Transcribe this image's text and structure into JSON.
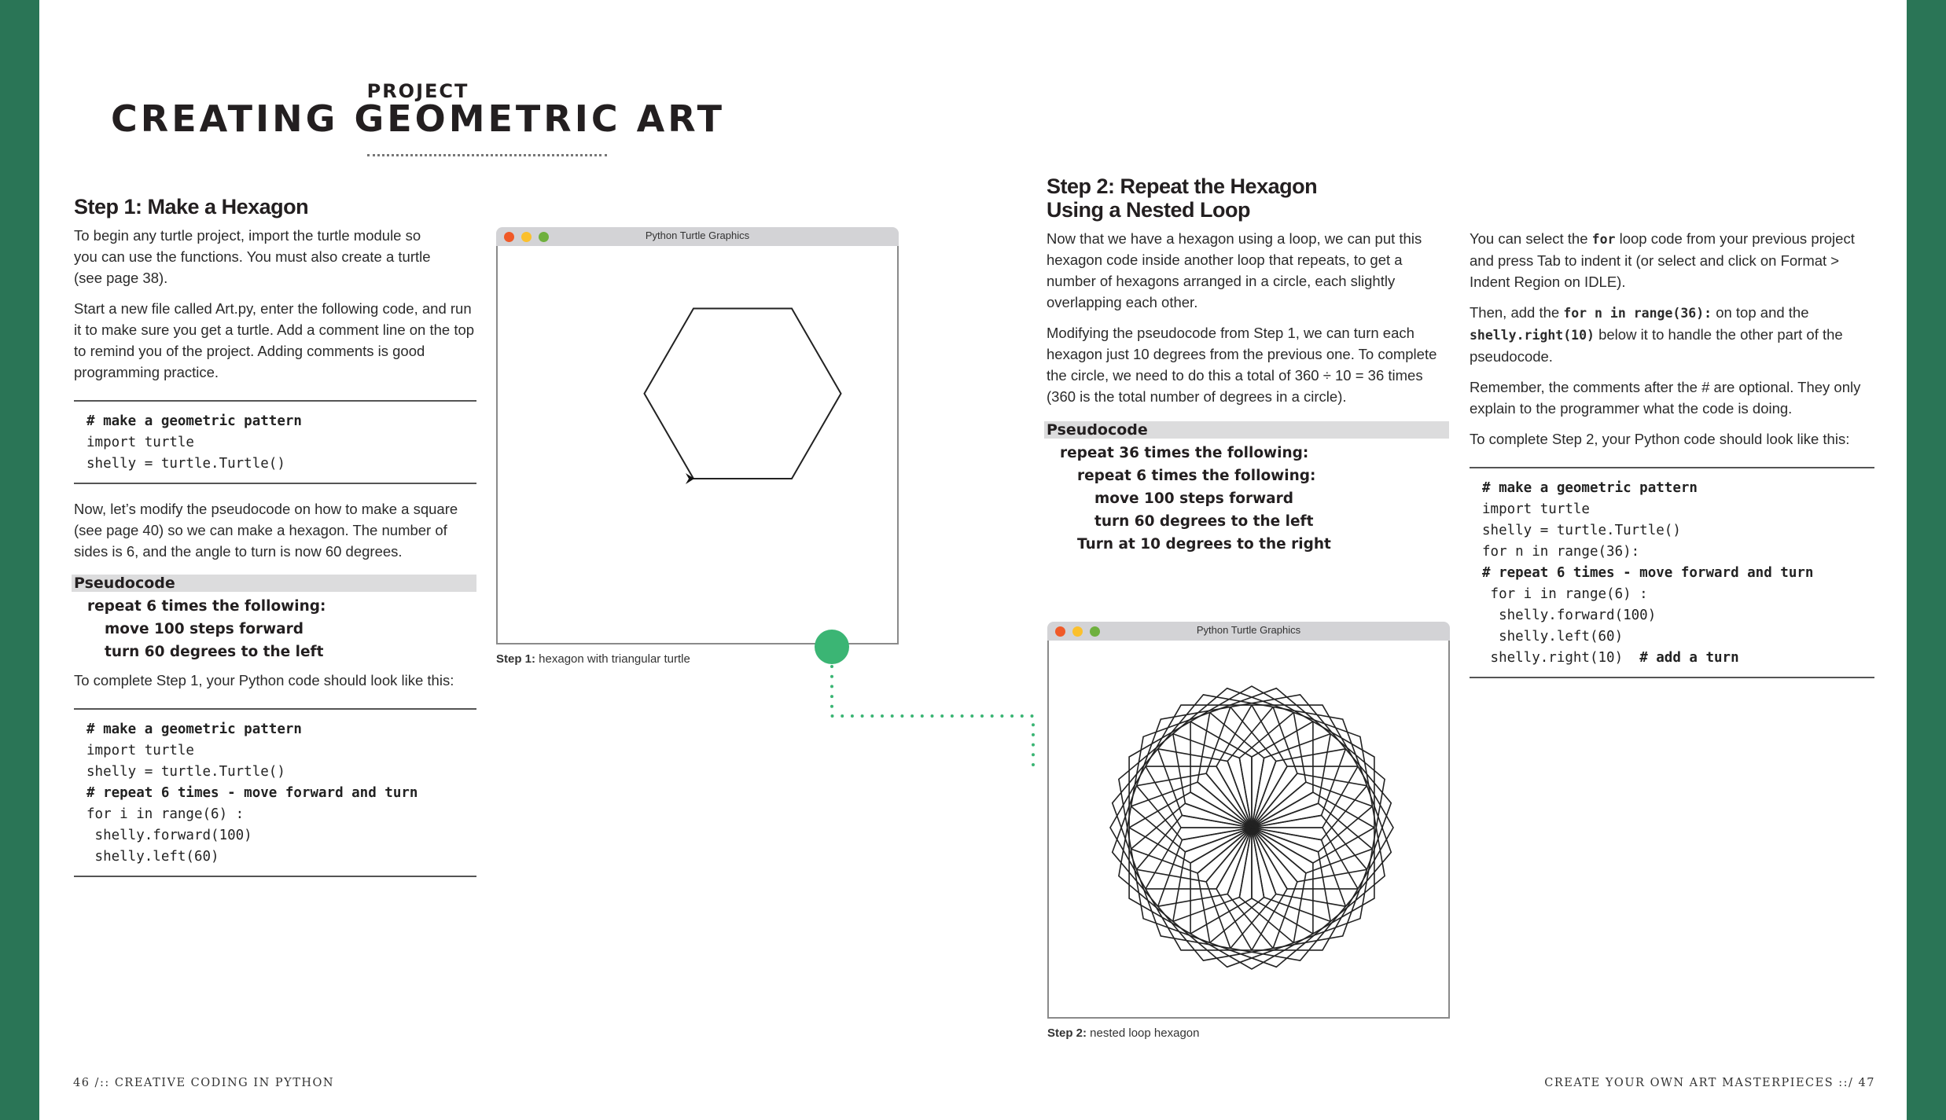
{
  "header": {
    "kicker": "PROJECT",
    "title": "CREATING GEOMETRIC ART"
  },
  "colors": {
    "sidebar_green": "#2a7556",
    "connector_green": "#3bb574",
    "window_close": "#f05a28",
    "window_minimize": "#fbc02d",
    "window_zoom": "#6fb03e"
  },
  "step1": {
    "heading": "Step 1: Make a Hexagon",
    "para1": "To begin any turtle project, import the turtle module so you can use the functions. You must also create a turtle (see page 38).",
    "para2": "Start a new file called Art.py, enter the following code, and run it to make sure you get a turtle. Add a comment line on the top to remind you of the project. Adding comments is good programming practice.",
    "code1": [
      {
        "text": "# make a geometric pattern",
        "bold": true
      },
      {
        "text": "import turtle",
        "bold": false
      },
      {
        "text": "shelly = turtle.Turtle()",
        "bold": false
      }
    ],
    "para3": "Now, let’s modify the pseudocode on how to make a square (see page 40) so we can make a hexagon. The number of sides is 6, and the angle to turn is now 60 degrees.",
    "pseudocode_label": "Pseudocode",
    "pseudocode": [
      {
        "text": "repeat 6 times the following:",
        "indent": 1
      },
      {
        "text": "move 100 steps forward",
        "indent": 2
      },
      {
        "text": "turn 60 degrees to the left",
        "indent": 2
      }
    ],
    "para4": "To complete Step 1, your Python code should look like this:",
    "code2": [
      {
        "text": "# make a geometric pattern",
        "bold": true
      },
      {
        "text": "import turtle",
        "bold": false
      },
      {
        "text": "shelly = turtle.Turtle()",
        "bold": false
      },
      {
        "text": "# repeat 6 times - move forward and turn",
        "bold": true
      },
      {
        "text": "for i in range(6) :",
        "bold": false
      },
      {
        "text": " shelly.forward(100)",
        "bold": false
      },
      {
        "text": " shelly.left(60)",
        "bold": false
      }
    ],
    "window_title": "Python Turtle Graphics",
    "caption_bold": "Step 1:",
    "caption_text": " hexagon with triangular turtle",
    "drawing": {
      "shape": "hexagon",
      "sides": 6,
      "forward": 100,
      "turn_left_deg": 60
    }
  },
  "step2": {
    "heading_line1": "Step 2: Repeat the Hexagon",
    "heading_line2": "Using a Nested Loop",
    "para1": "Now that we have a hexagon using a loop, we can put this hexagon code inside another loop that repeats, to get a number of hexagons arranged in a circle, each slightly overlapping each other.",
    "para2": "Modifying the pseudocode from Step 1, we can turn each hexagon just 10 degrees from the previous one. To complete the circle, we need to do this a total of 360 ÷ 10 = 36 times (360 is the total number of degrees in a circle).",
    "pseudocode_label": "Pseudocode",
    "pseudocode": [
      {
        "text": "repeat 36 times the following:",
        "indent": 1
      },
      {
        "text": "repeat 6 times the following:",
        "indent": 2
      },
      {
        "text": "move 100 steps forward",
        "indent": 3
      },
      {
        "text": "turn 60 degrees to the left",
        "indent": 3
      },
      {
        "text": "Turn at 10 degrees to the right",
        "indent": 2
      }
    ],
    "window_title": "Python Turtle Graphics",
    "caption_bold": "Step 2:",
    "caption_text": " nested loop hexagon",
    "drawing": {
      "shape": "hexagon-rosette",
      "repeats": 36,
      "sides": 6,
      "forward": 100,
      "turn_left_deg": 60,
      "turn_right_deg": 10
    },
    "col2_para1_pre": "You can select the ",
    "col2_para1_code": "for",
    "col2_para1_post": " loop code from your previous project and press Tab to indent it (or select and click on Format > Indent Region on IDLE).",
    "col2_para2_pre": "Then, add the ",
    "col2_para2_code1": "for n in range(36):",
    "col2_para2_mid": " on top and the ",
    "col2_para2_code2": "shelly.right(10)",
    "col2_para2_post": " below it to handle the other part of the pseudocode.",
    "col2_para3": "Remember, the comments after the # are optional. They only explain to the programmer what the code is doing.",
    "col2_para4": "To complete Step 2, your Python code should look like this:",
    "code": [
      {
        "text": "# make a geometric pattern",
        "bold": true
      },
      {
        "text": "import turtle",
        "bold": false
      },
      {
        "text": "shelly = turtle.Turtle()",
        "bold": false
      },
      {
        "text": "for n in range(36):",
        "bold": false
      },
      {
        "text": "# repeat 6 times - move forward and turn",
        "bold": true
      },
      {
        "text": " for i in range(6) :",
        "bold": false
      },
      {
        "text": "  shelly.forward(100)",
        "bold": false
      },
      {
        "text": "  shelly.left(60)",
        "bold": false
      },
      {
        "text": " shelly.right(10)  ",
        "bold": false,
        "trail": "# add a turn"
      }
    ]
  },
  "footer": {
    "left": "46 /:: CREATIVE CODING IN PYTHON",
    "right": "CREATE YOUR OWN ART MASTERPIECES ::/ 47"
  }
}
